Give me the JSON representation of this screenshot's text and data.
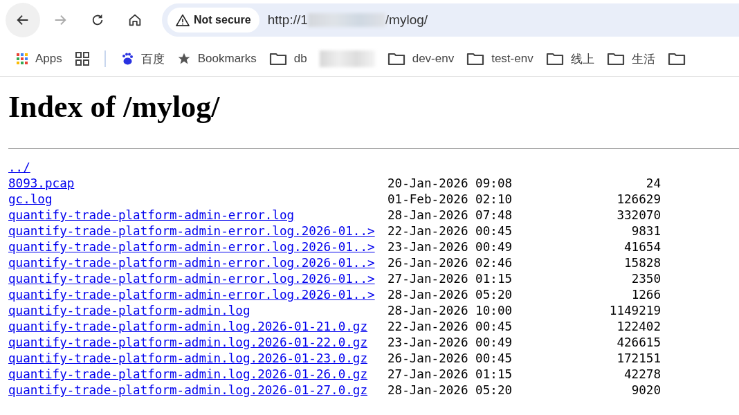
{
  "toolbar": {
    "security_chip": "Not secure",
    "url_prefix": "http://1",
    "url_suffix": "/mylog/",
    "forward_disabled": true
  },
  "bookmarks": [
    {
      "kind": "apps",
      "label": "Apps"
    },
    {
      "kind": "grid"
    },
    {
      "kind": "divider"
    },
    {
      "kind": "paw",
      "label": "百度"
    },
    {
      "kind": "star",
      "label": "Bookmarks"
    },
    {
      "kind": "folder",
      "label": "db"
    },
    {
      "kind": "blurred"
    },
    {
      "kind": "folder",
      "label": "dev-env"
    },
    {
      "kind": "folder",
      "label": "test-env"
    },
    {
      "kind": "folder",
      "label": "线上"
    },
    {
      "kind": "folder",
      "label": "生活"
    },
    {
      "kind": "folder"
    }
  ],
  "page": {
    "heading": "Index of /mylog/",
    "entries": [
      {
        "name": "../"
      },
      {
        "name": "8093.pcap",
        "date": "20-Jan-2026 09:08",
        "size": "24"
      },
      {
        "name": "gc.log",
        "date": "01-Feb-2026 02:10",
        "size": "126629"
      },
      {
        "name": "quantify-trade-platform-admin-error.log",
        "date": "28-Jan-2026 07:48",
        "size": "332070"
      },
      {
        "name": "quantify-trade-platform-admin-error.log.2026-01..>",
        "date": "22-Jan-2026 00:45",
        "size": "9831"
      },
      {
        "name": "quantify-trade-platform-admin-error.log.2026-01..>",
        "date": "23-Jan-2026 00:49",
        "size": "41654"
      },
      {
        "name": "quantify-trade-platform-admin-error.log.2026-01..>",
        "date": "26-Jan-2026 02:46",
        "size": "15828"
      },
      {
        "name": "quantify-trade-platform-admin-error.log.2026-01..>",
        "date": "27-Jan-2026 01:15",
        "size": "2350"
      },
      {
        "name": "quantify-trade-platform-admin-error.log.2026-01..>",
        "date": "28-Jan-2026 05:20",
        "size": "1266"
      },
      {
        "name": "quantify-trade-platform-admin.log",
        "date": "28-Jan-2026 10:00",
        "size": "1149219"
      },
      {
        "name": "quantify-trade-platform-admin.log.2026-01-21.0.gz",
        "date": "22-Jan-2026 00:45",
        "size": "122402"
      },
      {
        "name": "quantify-trade-platform-admin.log.2026-01-22.0.gz",
        "date": "23-Jan-2026 00:49",
        "size": "426615"
      },
      {
        "name": "quantify-trade-platform-admin.log.2026-01-23.0.gz",
        "date": "26-Jan-2026 00:45",
        "size": "172151"
      },
      {
        "name": "quantify-trade-platform-admin.log.2026-01-26.0.gz",
        "date": "27-Jan-2026 01:15",
        "size": "42278"
      },
      {
        "name": "quantify-trade-platform-admin.log.2026-01-27.0.gz",
        "date": "28-Jan-2026 05:20",
        "size": "9020"
      }
    ]
  }
}
